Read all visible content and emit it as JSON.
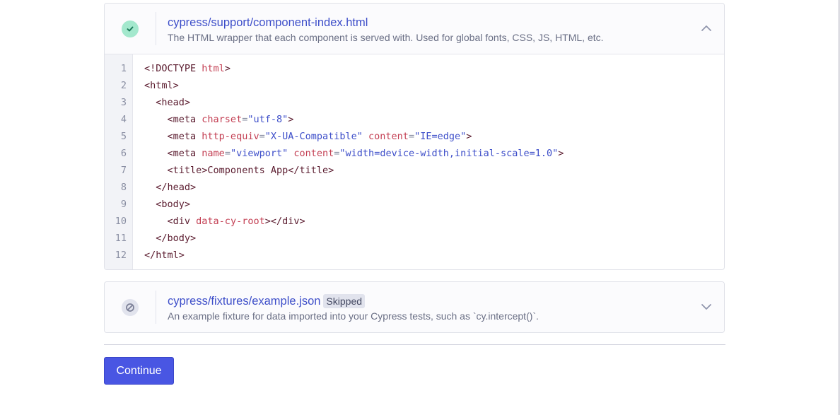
{
  "files": [
    {
      "path": "cypress/support/component-index.html",
      "description": "The HTML wrapper that each component is served with. Used for global fonts, CSS, JS, HTML, etc.",
      "status": "success",
      "status_icon": "check-icon",
      "expanded": true,
      "line_numbers": [
        "1",
        "2",
        "3",
        "4",
        "5",
        "6",
        "7",
        "8",
        "9",
        "10",
        "11",
        "12"
      ]
    },
    {
      "path": "cypress/fixtures/example.json",
      "badge": "Skipped",
      "description": "An example fixture for data imported into your Cypress tests, such as `cy.intercept()`.",
      "status": "skipped",
      "status_icon": "prohibited-icon",
      "expanded": false
    }
  ],
  "code": {
    "l1": {
      "t1": "<!DOCTYPE",
      "a1": "html",
      "t2": ">"
    },
    "l2": {
      "t1": "<html>"
    },
    "l3": {
      "t1": "<head>"
    },
    "l4": {
      "t1": "<meta",
      "a1": "charset",
      "p1": "=",
      "s1": "\"utf-8\"",
      "t2": ">"
    },
    "l5": {
      "t1": "<meta",
      "a1": "http-equiv",
      "p1": "=",
      "s1": "\"X-UA-Compatible\"",
      "a2": "content",
      "p2": "=",
      "s2": "\"IE=edge\"",
      "t2": ">"
    },
    "l6": {
      "t1": "<meta",
      "a1": "name",
      "p1": "=",
      "s1": "\"viewport\"",
      "a2": "content",
      "p2": "=",
      "s2": "\"width=device-width,initial-scale=1.0\"",
      "t2": ">"
    },
    "l7": {
      "t1": "<title>",
      "x1": "Components App",
      "t2": "</title>"
    },
    "l8": {
      "t1": "</head>"
    },
    "l9": {
      "t1": "<body>"
    },
    "l10": {
      "t1": "<div",
      "a1": "data-cy-root",
      "t2": "></div>"
    },
    "l11": {
      "t1": "</body>"
    },
    "l12": {
      "t1": "</html>"
    }
  },
  "continue_label": "Continue",
  "colors": {
    "accent": "#4956e3",
    "link": "#3d4ec9",
    "success": "#a3e8cd",
    "skipped": "#e1e3ed"
  }
}
